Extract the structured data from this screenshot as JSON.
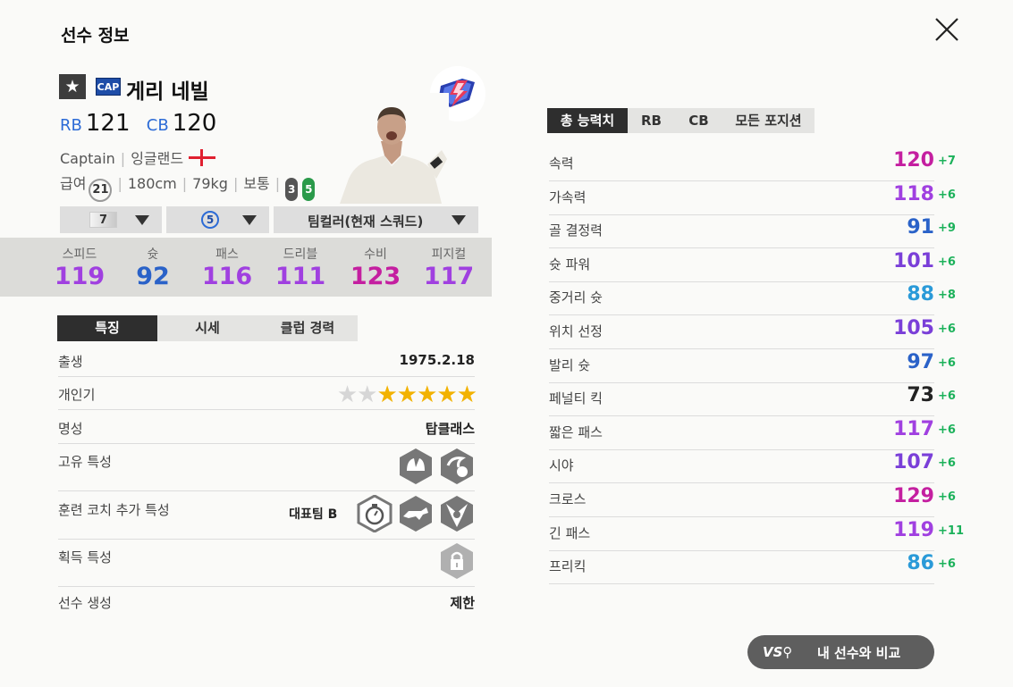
{
  "page": {
    "title": "선수 정보"
  },
  "player": {
    "grade_icon": "star-icon",
    "season_badge": "CAP",
    "name": "게리 네빌",
    "positions": [
      {
        "pos": "RB",
        "ovr": "121"
      },
      {
        "pos": "CB",
        "ovr": "120"
      }
    ],
    "club": "Captain",
    "nation": "잉글랜드",
    "salary_label": "급여",
    "salary": "21",
    "height": "180cm",
    "weight": "79kg",
    "body_type": "보통",
    "weak_foot_left": "3",
    "weak_foot_right": "5"
  },
  "selectors": {
    "grade": "7",
    "enhance": "5",
    "team_color": "팀컬러(현재 스쿼드)"
  },
  "summary_stats": [
    {
      "label": "스피드",
      "value": "119",
      "color": "#a040e0"
    },
    {
      "label": "슛",
      "value": "92",
      "color": "#2a62c8"
    },
    {
      "label": "패스",
      "value": "116",
      "color": "#a040e0"
    },
    {
      "label": "드리블",
      "value": "111",
      "color": "#a040e0"
    },
    {
      "label": "수비",
      "value": "123",
      "color": "#c41fa0"
    },
    {
      "label": "피지컬",
      "value": "117",
      "color": "#a040e0"
    }
  ],
  "left_tabs": [
    "특징",
    "시세",
    "클럽 경력"
  ],
  "details": {
    "birth_label": "출생",
    "birth": "1975.2.18",
    "popularity_label": "개인기",
    "popularity_stars": 5,
    "popularity_max": 7,
    "reputation_label": "명성",
    "reputation": "탑클래스",
    "unique_traits_label": "고유 특성",
    "coach_traits_label": "훈련 코치 추가 특성",
    "coach_traits_value": "대표팀 B",
    "acquired_traits_label": "획득 특성",
    "creation_label": "선수 생성",
    "creation": "제한"
  },
  "right_tabs": [
    "총 능력치",
    "RB",
    "CB",
    "모든 포지션"
  ],
  "attributes": [
    {
      "name": "속력",
      "value": "120",
      "delta": "+7",
      "color": "#c41fa0"
    },
    {
      "name": "가속력",
      "value": "118",
      "delta": "+6",
      "color": "#a040e0"
    },
    {
      "name": "골 결정력",
      "value": "91",
      "delta": "+9",
      "color": "#2a62c8"
    },
    {
      "name": "슛 파워",
      "value": "101",
      "delta": "+6",
      "color": "#7a3fd8"
    },
    {
      "name": "중거리 슛",
      "value": "88",
      "delta": "+8",
      "color": "#2a9ad8"
    },
    {
      "name": "위치 선정",
      "value": "105",
      "delta": "+6",
      "color": "#7a3fd8"
    },
    {
      "name": "발리 슛",
      "value": "97",
      "delta": "+6",
      "color": "#2a62c8"
    },
    {
      "name": "페널티 킥",
      "value": "73",
      "delta": "+6",
      "color": "#222222"
    },
    {
      "name": "짧은 패스",
      "value": "117",
      "delta": "+6",
      "color": "#a040e0"
    },
    {
      "name": "시야",
      "value": "107",
      "delta": "+6",
      "color": "#7a3fd8"
    },
    {
      "name": "크로스",
      "value": "129",
      "delta": "+6",
      "color": "#c41fa0"
    },
    {
      "name": "긴 패스",
      "value": "119",
      "delta": "+11",
      "color": "#a040e0"
    },
    {
      "name": "프리킥",
      "value": "86",
      "delta": "+6",
      "color": "#2a9ad8"
    }
  ],
  "compare_button": {
    "icon": "vs-search-icon",
    "label": "내 선수와 비교"
  }
}
